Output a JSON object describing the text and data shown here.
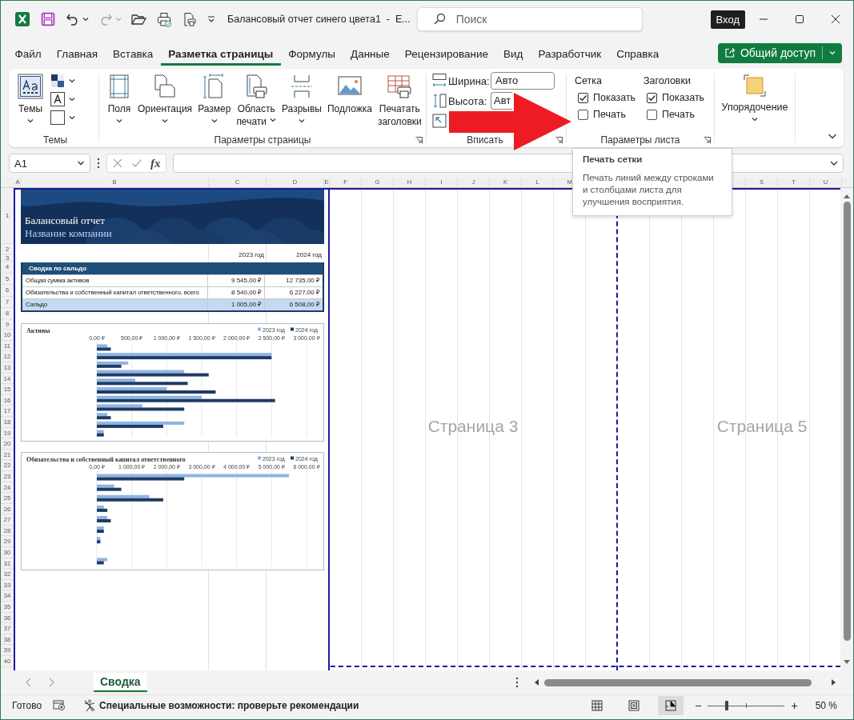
{
  "window": {
    "title": "Балансовый отчет синего цвета1  -  E...",
    "search_placeholder": "Поиск",
    "sign_in": "Вход"
  },
  "tabs": [
    {
      "label": "Файл",
      "selected": false
    },
    {
      "label": "Главная",
      "selected": false
    },
    {
      "label": "Вставка",
      "selected": false
    },
    {
      "label": "Разметка страницы",
      "selected": true
    },
    {
      "label": "Формулы",
      "selected": false
    },
    {
      "label": "Данные",
      "selected": false
    },
    {
      "label": "Рецензирование",
      "selected": false
    },
    {
      "label": "Вид",
      "selected": false
    },
    {
      "label": "Разработчик",
      "selected": false
    },
    {
      "label": "Справка",
      "selected": false
    }
  ],
  "share_button": "Общий доступ",
  "ribbon": {
    "themes": {
      "button": "Темы",
      "label": "Темы"
    },
    "page_setup": {
      "label": "Параметры страницы",
      "buttons": [
        {
          "kind": "margins",
          "lines": [
            "Поля"
          ],
          "dropdown": true
        },
        {
          "kind": "orientation",
          "lines": [
            "Ориентация"
          ],
          "dropdown": true
        },
        {
          "kind": "size",
          "lines": [
            "Размер"
          ],
          "dropdown": true
        },
        {
          "kind": "print_area",
          "lines": [
            "Область",
            "печати"
          ],
          "dropdown": true
        },
        {
          "kind": "breaks",
          "lines": [
            "Разрывы"
          ],
          "dropdown": true
        },
        {
          "kind": "background",
          "lines": [
            "Подложка"
          ],
          "dropdown": false
        },
        {
          "kind": "print_titles",
          "lines": [
            "Печатать",
            "заголовки"
          ],
          "dropdown": false
        }
      ]
    },
    "fit": {
      "label": "Вписать",
      "rows": [
        {
          "kind": "width",
          "label": "Ширина:",
          "value": "Авто"
        },
        {
          "kind": "height",
          "label": "Высота:",
          "value": "Авт"
        }
      ]
    },
    "sheet_options": {
      "label": "Параметры листа",
      "columns": [
        {
          "heading": "Сетка",
          "items": [
            {
              "label": "Показать",
              "checked": true
            },
            {
              "label": "Печать",
              "checked": false
            }
          ]
        },
        {
          "heading": "Заголовки",
          "items": [
            {
              "label": "Показать",
              "checked": true
            },
            {
              "label": "Печать",
              "checked": false
            }
          ]
        }
      ]
    },
    "arrange": {
      "label": "Упорядочение"
    }
  },
  "tooltip": {
    "title": "Печать сетки",
    "text": "Печать линий между строками и столбцами листа для улучшения восприятия."
  },
  "formula_bar": {
    "name_box": "A1",
    "fx": "fx"
  },
  "sheet": {
    "column_headers_left": [
      "A",
      "B",
      "C",
      "D",
      "E"
    ],
    "column_headers_right": [
      [
        "F",
        "G",
        "H",
        "I",
        "J",
        "K",
        "L",
        "M"
      ],
      [
        "S",
        "T",
        "U"
      ]
    ],
    "row_numbers": [
      "1",
      "2",
      "3",
      "4",
      "5",
      "6",
      "7",
      "8",
      "9",
      "10",
      "11",
      "12",
      "13",
      "14",
      "15",
      "16",
      "17",
      "18",
      "19",
      "20",
      "21",
      "22",
      "23",
      "24",
      "25",
      "26",
      "27",
      "28",
      "29",
      "30",
      "31",
      "32",
      "33",
      "34",
      "35",
      "36",
      "37",
      "38",
      "39",
      "40"
    ],
    "page_labels": [
      "Страница 3",
      "Страница 5"
    ],
    "report": {
      "title": "Балансовый отчет",
      "subtitle": "Название компании",
      "years": [
        "2023 год",
        "2024 год"
      ],
      "summary": {
        "heading": "Сводка по сальдо",
        "rows": [
          {
            "label": "Общая сумма активов",
            "values": [
              "9 545,00 ₽",
              "12 735,00 ₽"
            ],
            "highlighted": false
          },
          {
            "label": "Обязательства и собственный капитал ответственного, всего",
            "values": [
              "8 540,00 ₽",
              "6 227,00 ₽"
            ],
            "highlighted": false
          },
          {
            "label": "Сальдо",
            "values": [
              "1 005,00 ₽",
              "6 508,00 ₽"
            ],
            "highlighted": true
          }
        ]
      }
    },
    "charts": [
      {
        "title": "Активы",
        "chart_data": {
          "type": "bar",
          "orientation": "horizontal",
          "grid": true,
          "legend": true,
          "xlim": [
            0,
            3000
          ],
          "xticks": [
            {
              "value": 0,
              "label": "0,00 ₽"
            },
            {
              "value": 500,
              "label": "500,00 ₽"
            },
            {
              "value": 1000,
              "label": "1 000,00 ₽"
            },
            {
              "value": 1500,
              "label": "1 500,00 ₽"
            },
            {
              "value": 2000,
              "label": "2 000,00 ₽"
            },
            {
              "value": 2500,
              "label": "2 500,00 ₽"
            },
            {
              "value": 3000,
              "label": "3 000,00 ₽"
            }
          ],
          "series": [
            {
              "name": "2023 год",
              "color": "#8eb4e3",
              "values": [
                150,
                2500,
                450,
                1250,
                550,
                1000,
                1500,
                650,
                150,
                1250,
                100
              ]
            },
            {
              "name": "2024 год",
              "color": "#1f3b64",
              "values": [
                200,
                2500,
                350,
                1600,
                1300,
                1700,
                2550,
                1250,
                200,
                950,
                100
              ]
            }
          ]
        }
      },
      {
        "title": "Обязательства и собственный капитал ответственного",
        "chart_data": {
          "type": "bar",
          "orientation": "horizontal",
          "grid": true,
          "legend": true,
          "xlim": [
            0,
            6000
          ],
          "xticks": [
            {
              "value": 0,
              "label": "0,00 ₽"
            },
            {
              "value": 1000,
              "label": "1 000,00 ₽"
            },
            {
              "value": 2000,
              "label": "2 000,00 ₽"
            },
            {
              "value": 3000,
              "label": "3 000,00 ₽"
            },
            {
              "value": 4000,
              "label": "4 000,00 ₽"
            },
            {
              "value": 5000,
              "label": "5 000,00 ₽"
            },
            {
              "value": 6000,
              "label": "6 000,00 ₽"
            }
          ],
          "series": [
            {
              "name": "2023 год",
              "color": "#8eb4e3",
              "values": [
                5500,
                500,
                1500,
                200,
                300,
                200,
                100,
                null,
                300
              ]
            },
            {
              "name": "2024 год",
              "color": "#1f3b64",
              "values": [
                2500,
                700,
                1900,
                300,
                400,
                200,
                100,
                null,
                200
              ]
            }
          ]
        }
      }
    ]
  },
  "sheet_tabs": [
    {
      "label": "Сводка",
      "selected": true
    }
  ],
  "status_bar": {
    "ready": "Готово",
    "accessibility": "Специальные возможности: проверьте рекомендации",
    "views": [
      {
        "kind": "normal",
        "selected": false
      },
      {
        "kind": "page_layout",
        "selected": false
      },
      {
        "kind": "page_break",
        "selected": true
      }
    ],
    "zoom_minus": "−",
    "zoom_plus": "+",
    "zoom": {
      "level": 0.25
    },
    "zoom_label": "50 %"
  }
}
